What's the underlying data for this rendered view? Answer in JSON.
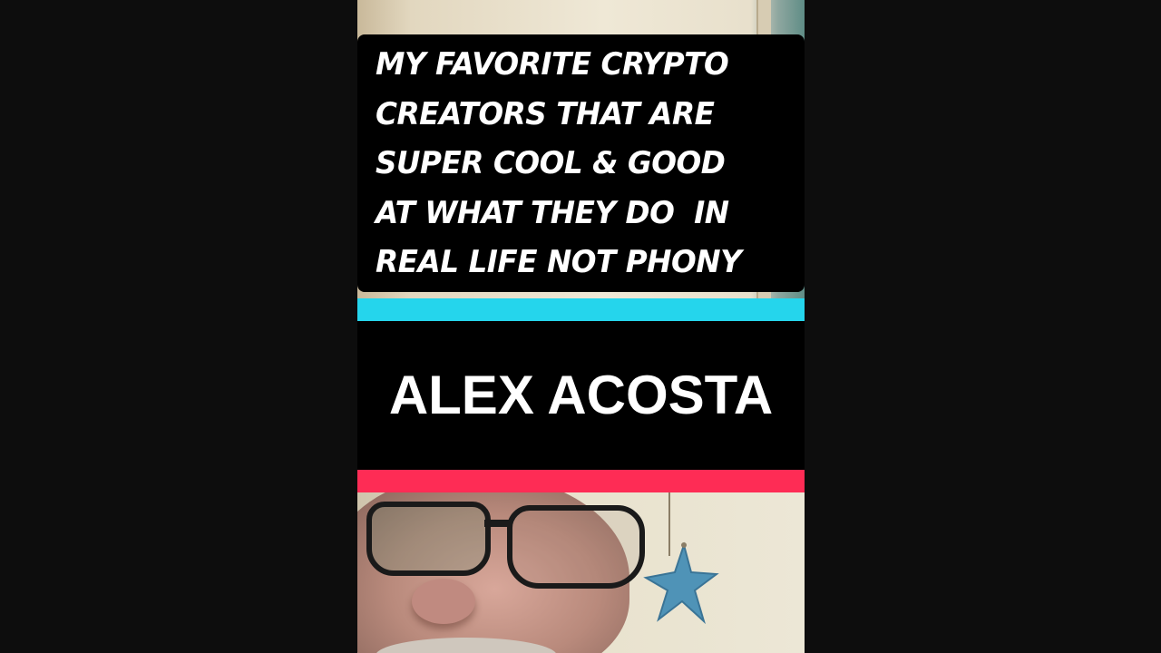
{
  "caption": {
    "text": "MY FAVORITE CRYPTO\nCREATORS THAT ARE\nSUPER COOL & GOOD\nAT WHAT THEY DO  IN\nREAL LIFE NOT PHONY"
  },
  "name_label": {
    "text": "ALEX ACOSTA"
  },
  "colors": {
    "background": "#0d0d0d",
    "caption_bg": "#000000",
    "cyan_accent": "#25d5ec",
    "red_accent": "#fe2c55",
    "text": "#ffffff"
  },
  "icons": {
    "decoration": "starfish-icon"
  }
}
